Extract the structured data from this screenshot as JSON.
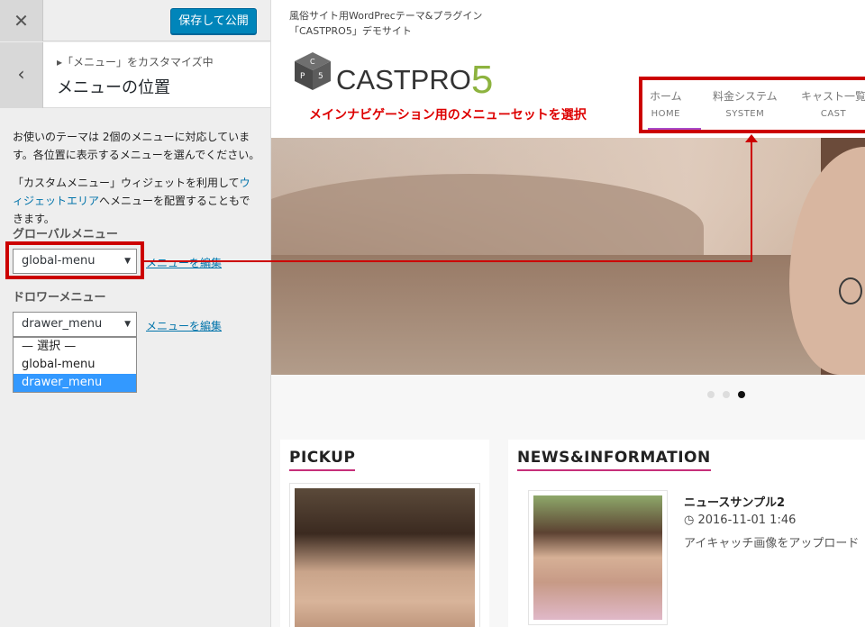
{
  "customizer": {
    "close_glyph": "✕",
    "publish_label": "保存して公開",
    "back_glyph": "‹",
    "breadcrumb": "▸「メニュー」をカスタマイズ中",
    "section_title": "メニューの位置",
    "description_1": "お使いのテーマは 2個のメニューに対応しています。各位置に表示するメニューを選んでください。",
    "description_2_pre": "「カスタムメニュー」ウィジェットを利用して",
    "description_2_link": "ウィジェットエリア",
    "description_2_post": "へメニューを配置することもできます。",
    "locations": [
      {
        "label": "グローバルメニュー",
        "selected": "global-menu",
        "edit_label": "メニューを編集"
      },
      {
        "label": "ドロワーメニュー",
        "selected": "drawer_menu",
        "edit_label": "メニューを編集"
      }
    ],
    "dropdown_options": [
      "— 選択 —",
      "global-menu",
      "drawer_menu"
    ],
    "dropdown_selected_index": 2
  },
  "preview": {
    "tagline": "風俗サイト用WordPrecテーマ&プラグイン「CASTPRO5」デモサイト",
    "logo_text": "CASTPRO",
    "logo_number": "5",
    "annotation": "メインナビゲーション用のメニューセットを選択",
    "nav": [
      {
        "ja": "ホーム",
        "en": "HOME"
      },
      {
        "ja": "料金システム",
        "en": "SYSTEM"
      },
      {
        "ja": "キャスト一覧",
        "en": "CAST"
      }
    ],
    "slider_dots": 3,
    "slider_active_index": 2,
    "pickup_title": "PICKUP",
    "news_title": "NEWS&INFORMATION",
    "news_item": {
      "title": "ニュースサンプル2",
      "date": "2016-11-01 1:46",
      "excerpt": "アイキャッチ画像をアップロード"
    }
  },
  "colors": {
    "primary_button": "#0085ba",
    "annotation_red": "#cc0000",
    "logo_green": "#8db33f",
    "heading_underline": "#c62f7a",
    "nav_active": "#a94ac9"
  },
  "icons": {
    "close": "close-icon",
    "back": "chevron-left-icon",
    "clock": "clock-icon",
    "dropdown_arrow": "triangle-down-icon",
    "logo_mark": "cube-logo-icon"
  }
}
